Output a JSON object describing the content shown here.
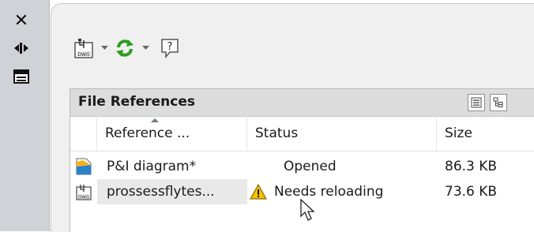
{
  "palette_strip": {
    "close_glyph": "✕",
    "icons": [
      "close-icon",
      "auto-hide-icon",
      "properties-icon"
    ]
  },
  "toolbar": {
    "icons": [
      "attach-dwg-icon",
      "refresh-icon",
      "help-icon"
    ],
    "help_glyph": "?"
  },
  "file_references": {
    "title": "File References",
    "columns": [
      "Reference ...",
      "Status",
      "Size"
    ],
    "rows": [
      {
        "icon": "drawing-folder-icon",
        "reference": "P&I diagram*",
        "status": "Opened",
        "status_icon": "",
        "size": "86.3 KB"
      },
      {
        "icon": "dwg-file-icon",
        "reference": "prossessflytes...",
        "status": "Needs reloading",
        "status_icon": "warning-icon",
        "size": "73.6 KB"
      }
    ]
  },
  "colors": {
    "strip": "#cfd3d7",
    "panel": "#f0f0f0",
    "header": "#dcdcdc",
    "refresh_green": "#2e9d1f",
    "warning_yellow": "#f2c200"
  }
}
